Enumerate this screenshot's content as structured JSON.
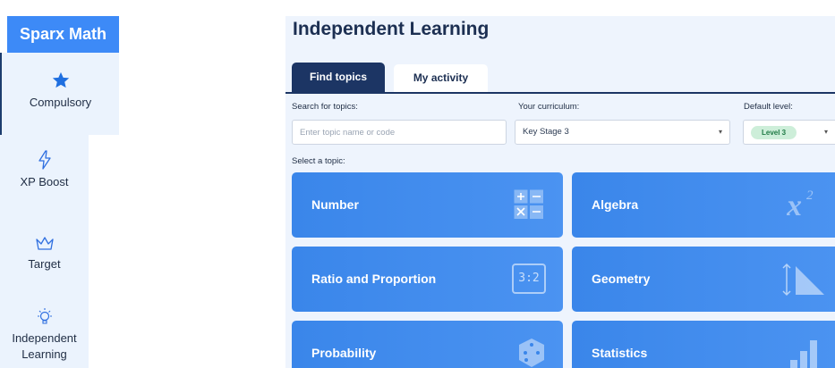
{
  "sidebar": {
    "brand": "Sparx Math",
    "items": [
      {
        "label": "Compulsory",
        "icon": "star-icon",
        "active": true
      },
      {
        "label": "XP Boost",
        "icon": "lightning-icon",
        "active": false
      },
      {
        "label": "Target",
        "icon": "crown-icon",
        "active": false
      },
      {
        "label": "Independent Learning",
        "label_line1": "Independent",
        "label_line2": "Learning",
        "icon": "lightbulb-icon",
        "active": false
      }
    ]
  },
  "main": {
    "title": "Independent Learning",
    "tabs": [
      {
        "label": "Find topics",
        "active": true
      },
      {
        "label": "My activity",
        "active": false
      }
    ],
    "search": {
      "label": "Search for topics:",
      "placeholder": "Enter topic name or code",
      "value": ""
    },
    "curriculum": {
      "label": "Your curriculum:",
      "value": "Key Stage 3"
    },
    "level": {
      "label": "Default level:",
      "value": "Level 3"
    },
    "select_label": "Select a topic:",
    "topics": [
      {
        "label": "Number",
        "icon": "calculator-symbols-icon"
      },
      {
        "label": "Algebra",
        "icon": "x-squared-icon"
      },
      {
        "label": "Ratio and Proportion",
        "icon": "ratio-icon",
        "icon_text": "3:2"
      },
      {
        "label": "Geometry",
        "icon": "triangle-ruler-icon"
      },
      {
        "label": "Probability",
        "icon": "dice-icon"
      },
      {
        "label": "Statistics",
        "icon": "bar-chart-icon"
      }
    ]
  },
  "colors": {
    "brand": "#3d8af7",
    "nav_bg": "#ebf3fd",
    "tab_active": "#1c3564",
    "card": "#3a86ea",
    "level_pill_bg": "#cdeed9",
    "level_pill_text": "#1f7a45"
  }
}
